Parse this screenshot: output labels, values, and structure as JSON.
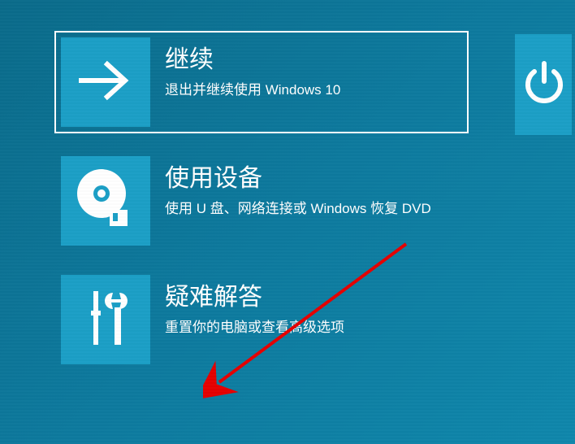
{
  "options": [
    {
      "title": "继续",
      "subtitle": "退出并继续使用 Windows 10",
      "icon": "arrow-right-icon",
      "selected": true
    },
    {
      "title": "使用设备",
      "subtitle": "使用 U 盘、网络连接或 Windows 恢复 DVD",
      "icon": "disc-icon",
      "selected": false
    },
    {
      "title": "疑难解答",
      "subtitle": "重置你的电脑或查看高级选项",
      "icon": "tools-icon",
      "selected": false
    }
  ],
  "power": {
    "label": "关闭电脑"
  },
  "colors": {
    "background": "#0d7a9e",
    "tile": "#1b9fc6",
    "text": "#ffffff",
    "annotation": "#e60000"
  }
}
